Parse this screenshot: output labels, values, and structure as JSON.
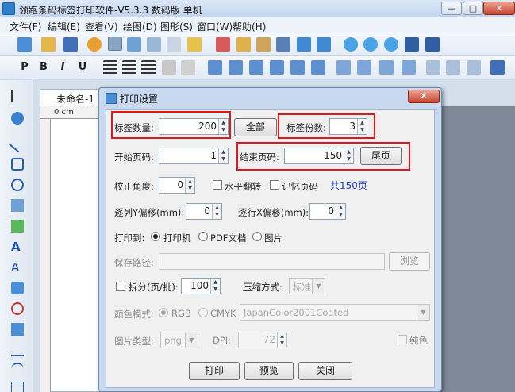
{
  "app": {
    "title": "领跑条码标签打印软件-V5.3.3 数码版 单机",
    "min_label": "—",
    "max_label": "□",
    "close_label": "✕"
  },
  "menu": [
    "文件(F)",
    "编辑(E)",
    "查看(V)",
    "绘图(D)",
    "图形(S)",
    "窗口(W)",
    "帮助(H)"
  ],
  "toolbar2_text": [
    "P",
    "B",
    "I",
    "U"
  ],
  "doc_tab": {
    "label": "未命名-1"
  },
  "ruler": {
    "unit": "0 cm"
  },
  "dialog": {
    "title": "打印设置",
    "close_label": "✕",
    "label_count": {
      "label": "标签数量:",
      "value": "200"
    },
    "all_button": "全部",
    "copies": {
      "label": "标签份数:",
      "value": "3"
    },
    "start_page": {
      "label": "开始页码:",
      "value": "1"
    },
    "end_page": {
      "label": "结束页码:",
      "value": "150"
    },
    "last_page_button": "尾页",
    "correct_angle": {
      "label": "校正角度:",
      "value": "0"
    },
    "flip_h": "水平翻转",
    "remember_page": "记忆页码",
    "total_pages": "共150页",
    "col_y_offset": {
      "label": "逐列Y偏移(mm):",
      "value": "0"
    },
    "row_x_offset": {
      "label": "逐行X偏移(mm):",
      "value": "0"
    },
    "print_to": {
      "label": "打印到:",
      "options": [
        "打印机",
        "PDF文档",
        "图片"
      ],
      "selected": "打印机"
    },
    "save_path": {
      "label": "保存路径:",
      "value": "",
      "browse": "浏览"
    },
    "split": {
      "label": "拆分(页/批):",
      "value": "100"
    },
    "compress": {
      "label": "压缩方式:",
      "value": "标准"
    },
    "color_mode": {
      "label": "颜色模式:",
      "options": [
        "RGB",
        "CMYK"
      ],
      "selected": "RGB",
      "profile": "JapanColor2001Coated"
    },
    "image_type": {
      "label": "图片类型:",
      "value": "png"
    },
    "dpi": {
      "label": "DPI:",
      "value": "72"
    },
    "pure_color": "纯色",
    "buttons": {
      "print": "打印",
      "preview": "预览",
      "close": "关闭"
    }
  },
  "colors": {
    "highlight": "#e3161b",
    "link": "#1f3fd6"
  }
}
